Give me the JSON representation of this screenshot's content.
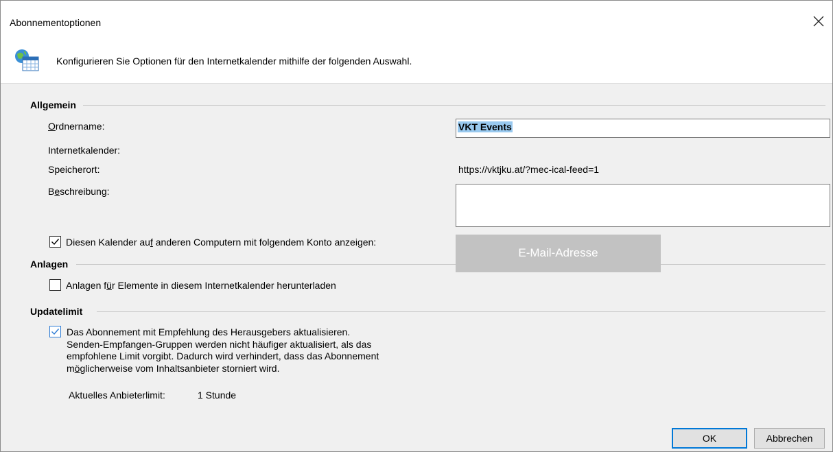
{
  "window": {
    "title": "Abonnementoptionen",
    "close_icon": "close-icon"
  },
  "header": {
    "icon": "globe-calendar-icon",
    "text": "Konfigurieren Sie Optionen für den Internetkalender mithilfe der folgenden Auswahl."
  },
  "general": {
    "heading": "Allgemein",
    "folder_label_access": "O",
    "folder_label_rest": "rdnername:",
    "folder_value": "VKT Events",
    "internet_calendar_label": "Internetkalender:",
    "location_label": "Speicherort:",
    "location_value": "https://vktjku.at/?mec-ical-feed=1",
    "description_label_pre": "B",
    "description_label_access": "e",
    "description_label_rest": "schreibung:",
    "description_value": "",
    "show_on_other_pre": "Diesen Kalender au",
    "show_on_other_access": "f",
    "show_on_other_rest": " anderen Computern mit folgendem Konto anzeigen:",
    "show_on_other_checked": true,
    "account_placeholder": "E-Mail-Adresse"
  },
  "attachments": {
    "heading": "Anlagen",
    "download_pre": "Anlagen f",
    "download_access": "ü",
    "download_rest": "r Elemente in diesem Internetkalender herunterladen",
    "download_checked": false
  },
  "update_limit": {
    "heading": "Updatelimit",
    "checked": true,
    "line1": "Das Abonnement mit Empfehlung des Herausgebers aktualisieren.",
    "line2": "Senden-Empfangen-Gruppen werden nicht häufiger aktualisiert, als das",
    "line3": "empfohlene Limit vorgibt. Dadurch wird verhindert, dass das Abonnement",
    "line4_pre": "m",
    "line4_access": "ö",
    "line4_rest": "glicherweise vom Inhaltsanbieter storniert wird.",
    "current_label": "Aktuelles Anbieterlimit:",
    "current_value": "1 Stunde"
  },
  "buttons": {
    "ok": "OK",
    "cancel": "Abbrechen"
  },
  "colors": {
    "accent": "#0078d7",
    "selection": "#99c9ef",
    "redaction": "#c2c2c2"
  }
}
